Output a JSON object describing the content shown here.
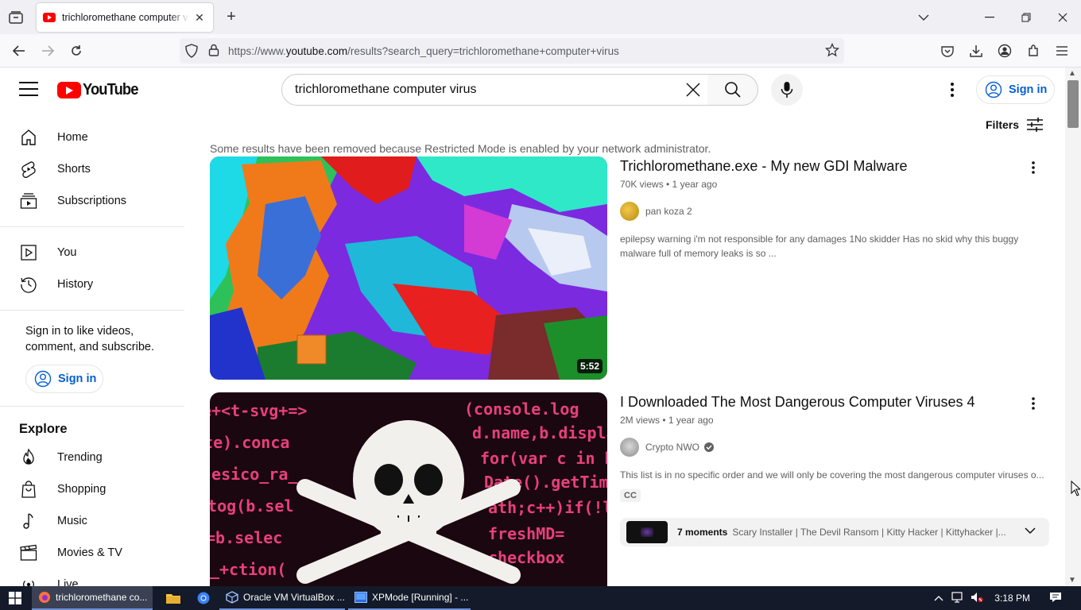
{
  "browser": {
    "tab_title": "trichloromethane computer virus - YouTube",
    "url_prefix": "https://www.",
    "url_host": "youtube.com",
    "url_path": "/results?search_query=trichloromethane+computer+virus"
  },
  "header": {
    "logo_text": "YouTube",
    "search_query": "trichloromethane computer virus",
    "sign_in": "Sign in"
  },
  "sidebar": {
    "items": [
      {
        "label": "Home"
      },
      {
        "label": "Shorts"
      },
      {
        "label": "Subscriptions"
      },
      {
        "label": "You"
      },
      {
        "label": "History"
      }
    ],
    "signin_prompt": "Sign in to like videos, comment, and subscribe.",
    "signin_button": "Sign in",
    "explore_title": "Explore",
    "explore_items": [
      {
        "label": "Trending"
      },
      {
        "label": "Shopping"
      },
      {
        "label": "Music"
      },
      {
        "label": "Movies & TV"
      },
      {
        "label": "Live"
      }
    ]
  },
  "results": {
    "filters_label": "Filters",
    "notice": "Some results have been removed because Restricted Mode is enabled by your network administrator.",
    "videos": [
      {
        "title": "Trichloromethane.exe - My new GDI Malware",
        "meta": "70K views • 1 year ago",
        "channel": "pan koza 2",
        "description": "epilepsy warning i'm not responsible for any damages 1No skidder Has no skid why this buggy malware full of memory leaks is so ...",
        "duration": "5:52"
      },
      {
        "title": "I Downloaded The Most Dangerous Computer Viruses 4",
        "meta": "2M views • 1 year ago",
        "channel": "Crypto NWO",
        "description": "This list is in no specific order and we will only be covering the most dangerous computer viruses o...",
        "cc": "CC",
        "moments_count": "7 moments",
        "moments_text": "Scary Installer | The Devil Ransom | Kitty Hacker | Kittyhacker |..."
      }
    ]
  },
  "taskbar": {
    "apps": [
      {
        "label": "trichloromethane co..."
      },
      {
        "label": "Oracle VM VirtualBox ..."
      },
      {
        "label": "XPMode [Running] - ..."
      }
    ],
    "time": "3:18 PM"
  }
}
